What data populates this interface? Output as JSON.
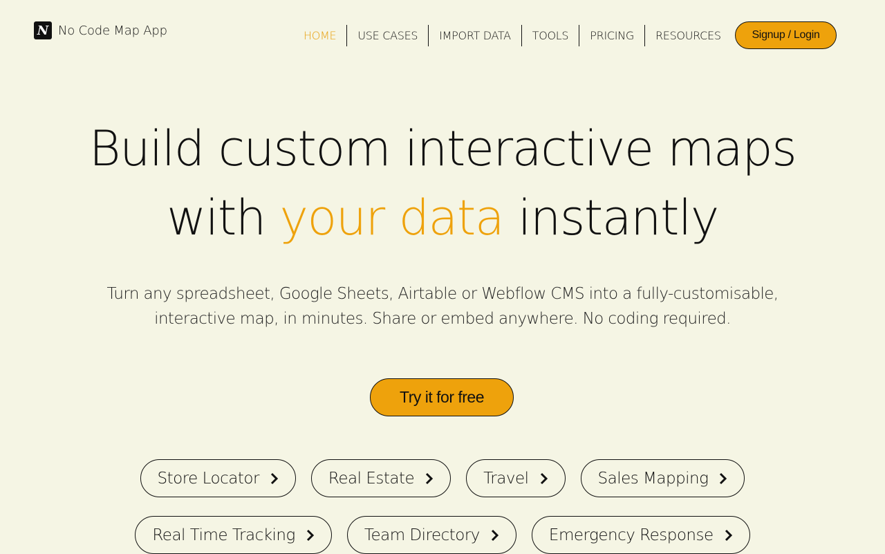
{
  "brand": {
    "logo_letter": "N",
    "name": "No Code Map App"
  },
  "nav": {
    "items": [
      {
        "label": "HOME",
        "active": true
      },
      {
        "label": "USE CASES",
        "active": false
      },
      {
        "label": "IMPORT DATA",
        "active": false
      },
      {
        "label": "TOOLS",
        "active": false
      },
      {
        "label": "PRICING",
        "active": false
      },
      {
        "label": "RESOURCES",
        "active": false
      }
    ],
    "signup_label": "Signup / Login"
  },
  "hero": {
    "title_line1": "Build custom interactive maps",
    "title_line2_pre": "with ",
    "title_line2_accent": "your data",
    "title_line2_post": " instantly",
    "subtitle": "Turn any spreadsheet, Google Sheets, Airtable or Webflow CMS into a fully-customisable, interactive map, in minutes. Share or embed anywhere. No coding required.",
    "cta_label": "Try it for free"
  },
  "use_cases": {
    "row1": [
      "Store Locator",
      "Real Estate",
      "Travel",
      "Sales Mapping"
    ],
    "row2": [
      "Real Time Tracking",
      "Team Directory",
      "Emergency Response"
    ],
    "chip_icon": "chevron-right-icon"
  },
  "colors": {
    "background": "#f5f5e4",
    "accent": "#eea20c",
    "text": "#111111"
  }
}
